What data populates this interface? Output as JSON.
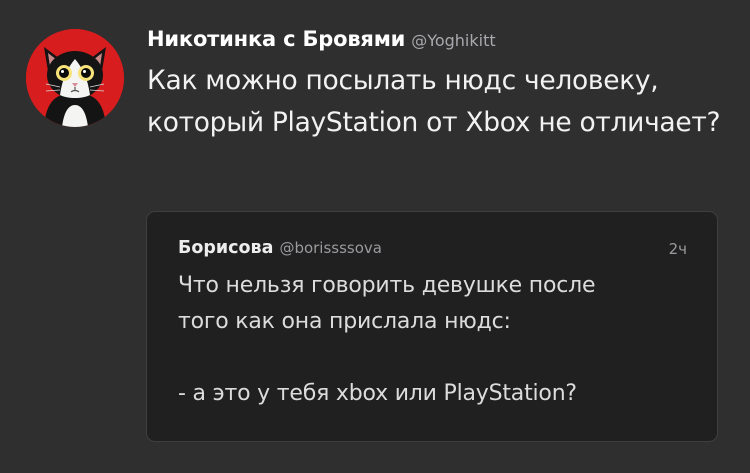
{
  "tweet": {
    "author_name": "Никотинка с Бровями",
    "author_handle": "@Yoghikitt",
    "avatar_icon": "cat-avatar-icon",
    "text": "Как можно посылать нюдс человеку, который PlayStation от Xbox не отличает?"
  },
  "quoted_tweet": {
    "author_name": "Борисова",
    "author_handle": "@borissssova",
    "time": "2ч",
    "lines": [
      "Что нельзя говорить девушке после",
      "того как она прислала нюдс:",
      "",
      "- а это у тебя xbox или PlayStation?"
    ]
  },
  "colors": {
    "background": "#2f2f30",
    "quote_background": "#202021",
    "avatar_background": "#d71d1d"
  }
}
